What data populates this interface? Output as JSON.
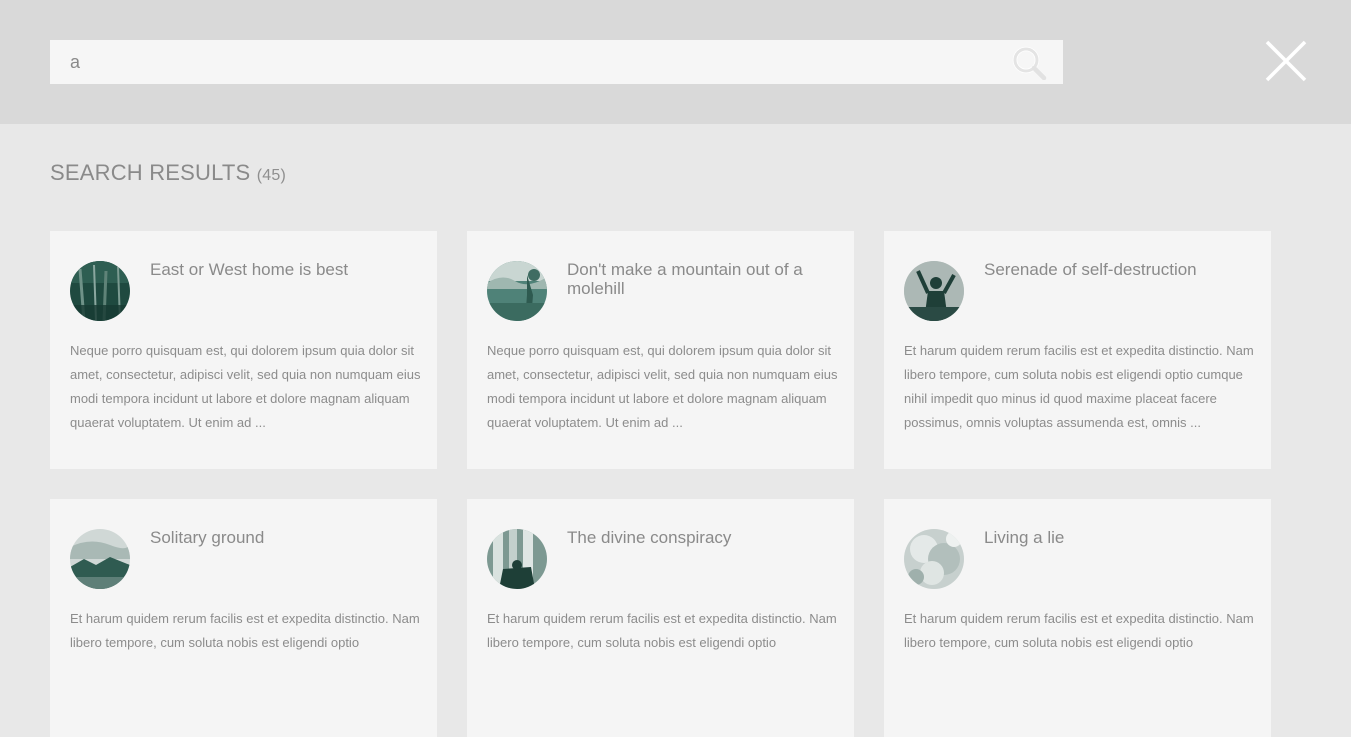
{
  "search": {
    "value": "a",
    "icon": "search-icon"
  },
  "close_icon": "close-icon",
  "results": {
    "heading": "SEARCH RESULTS",
    "count": "(45)",
    "items": [
      {
        "title": "East or West home is best",
        "excerpt": "Neque porro quisquam est, qui dolorem ipsum quia dolor sit amet, consectetur, adipisci velit, sed quia non numquam eius modi tempora incidunt ut labore et dolore magnam aliquam quaerat voluptatem. Ut enim ad ..."
      },
      {
        "title": "Don't make a mountain out of a molehill",
        "excerpt": "Neque porro quisquam est, qui dolorem ipsum quia dolor sit amet, consectetur, adipisci velit, sed quia non numquam eius modi tempora incidunt ut labore et dolore magnam aliquam quaerat voluptatem. Ut enim ad ..."
      },
      {
        "title": "Serenade of self-destruction",
        "excerpt": "Et harum quidem rerum facilis est et expedita distinctio. Nam libero tempore, cum soluta nobis est eligendi optio cumque nihil impedit quo minus id quod maxime placeat facere possimus, omnis voluptas assumenda est, omnis ..."
      },
      {
        "title": "Solitary ground",
        "excerpt": "Et harum quidem rerum facilis est et expedita distinctio. Nam libero tempore, cum soluta nobis est eligendi optio"
      },
      {
        "title": "The divine conspiracy",
        "excerpt": "Et harum quidem rerum facilis est et expedita distinctio. Nam libero tempore, cum soluta nobis est eligendi optio"
      },
      {
        "title": "Living a lie",
        "excerpt": "Et harum quidem rerum facilis est et expedita distinctio. Nam libero tempore, cum soluta nobis est eligendi optio"
      }
    ]
  },
  "colors": {
    "topbar_background": "#d9d9d9",
    "page_background": "#e8e8e8",
    "card_background": "#f5f5f5",
    "thumbnail_tint": "#2a5a50"
  }
}
